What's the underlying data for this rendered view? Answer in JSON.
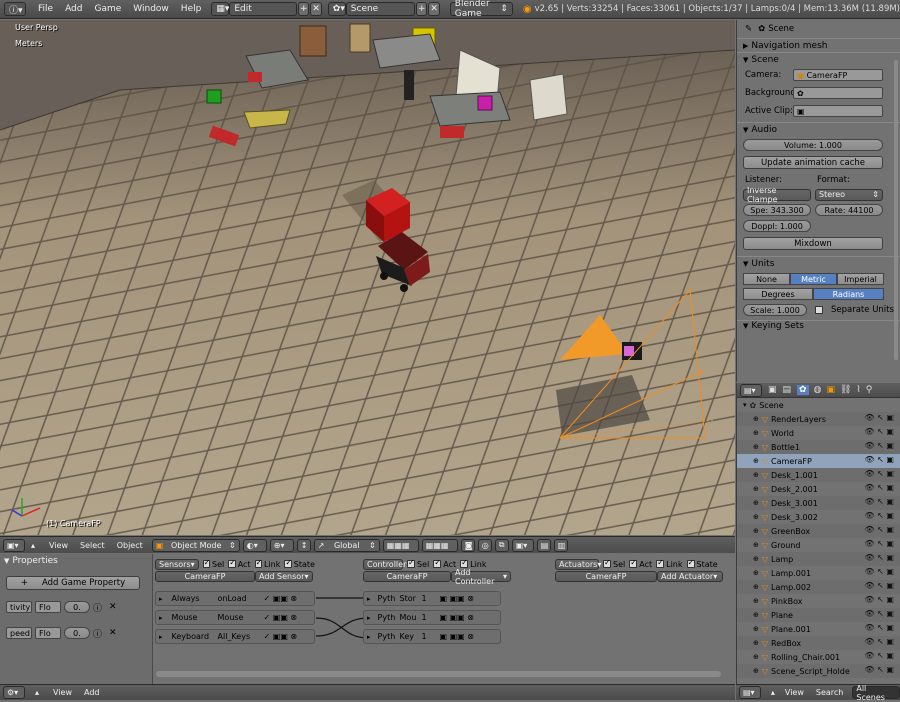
{
  "topbar": {
    "menus": [
      "File",
      "Add",
      "Game",
      "Window",
      "Help"
    ],
    "layout": "Edit",
    "scene": "Scene",
    "engine": "Blender Game",
    "stats": "v2.65 | Verts:33254 | Faces:33061 | Objects:1/37 | Lamps:0/4 | Mem:13.36M (11.89M)"
  },
  "viewport": {
    "view_name": "User Persp",
    "units": "Meters",
    "active_object": "(1) CameraFP"
  },
  "vp_header": {
    "menus": [
      "View",
      "Select",
      "Object"
    ],
    "mode": "Object Mode",
    "orientation": "Global"
  },
  "logic": {
    "props_title": "Properties",
    "add_prop": "Add Game Property",
    "properties": [
      {
        "name": "tivity",
        "type": "Flo",
        "value": "0."
      },
      {
        "name": "peed",
        "type": "Flo",
        "value": "0."
      }
    ],
    "sensors_label": "Sensors",
    "controllers_label": "Controllers",
    "actuators_label": "Actuators",
    "filters": [
      "Sel",
      "Act",
      "Link",
      "State"
    ],
    "object": "CameraFP",
    "add_sensor": "Add Sensor",
    "add_controller": "Add Controller",
    "add_actuator": "Add Actuator",
    "sensors": [
      {
        "name": "Always",
        "value": "onLoad"
      },
      {
        "name": "Mouse",
        "value": "Mouse"
      },
      {
        "name": "Keyboard",
        "value": "All_Keys"
      }
    ],
    "controllers": [
      {
        "type": "Pyth",
        "name": "Stor",
        "num": "1"
      },
      {
        "type": "Pyth",
        "name": "Mou",
        "num": "1"
      },
      {
        "type": "Pyth",
        "name": "Key",
        "num": "1"
      }
    ]
  },
  "bottombar": {
    "menus": [
      "View",
      "Add"
    ]
  },
  "right_props": {
    "context": "Scene",
    "nav_mesh": "Navigation mesh",
    "scene_section": "Scene",
    "camera_label": "Camera:",
    "camera_value": "CameraFP",
    "background_label": "Background",
    "active_clip_label": "Active Clip:",
    "audio_section": "Audio",
    "volume": "Volume: 1.000",
    "update_anim": "Update animation cache",
    "listener_label": "Listener:",
    "format_label": "Format:",
    "listener_value": "Inverse Clampe",
    "format_value": "Stereo",
    "speed": "Spe: 343.300",
    "rate": "Rate: 44100",
    "doppler": "Doppl: 1.000",
    "mixdown": "Mixdown",
    "units_section": "Units",
    "unit_systems": [
      "None",
      "Metric",
      "Imperial"
    ],
    "rotation": [
      "Degrees",
      "Radians"
    ],
    "scale": "Scale: 1.000",
    "separate_units": "Separate Units",
    "keying_sets": "Keying Sets"
  },
  "outliner": {
    "items": [
      {
        "name": "Scene",
        "level": 0
      },
      {
        "name": "RenderLayers",
        "level": 1
      },
      {
        "name": "World",
        "level": 1
      },
      {
        "name": "Bottle1",
        "level": 1
      },
      {
        "name": "CameraFP",
        "level": 1
      },
      {
        "name": "Desk_1.001",
        "level": 1
      },
      {
        "name": "Desk_2.001",
        "level": 1
      },
      {
        "name": "Desk_3.001",
        "level": 1
      },
      {
        "name": "Desk_3.002",
        "level": 1
      },
      {
        "name": "GreenBox",
        "level": 1
      },
      {
        "name": "Ground",
        "level": 1
      },
      {
        "name": "Lamp",
        "level": 1
      },
      {
        "name": "Lamp.001",
        "level": 1
      },
      {
        "name": "Lamp.002",
        "level": 1
      },
      {
        "name": "PinkBox",
        "level": 1
      },
      {
        "name": "Plane",
        "level": 1
      },
      {
        "name": "Plane.001",
        "level": 1
      },
      {
        "name": "RedBox",
        "level": 1
      },
      {
        "name": "Rolling_Chair.001",
        "level": 1
      },
      {
        "name": "Scene_Script_Holde",
        "level": 1
      }
    ],
    "footer_menus": [
      "View",
      "Search"
    ],
    "filter": "All Scenes"
  }
}
